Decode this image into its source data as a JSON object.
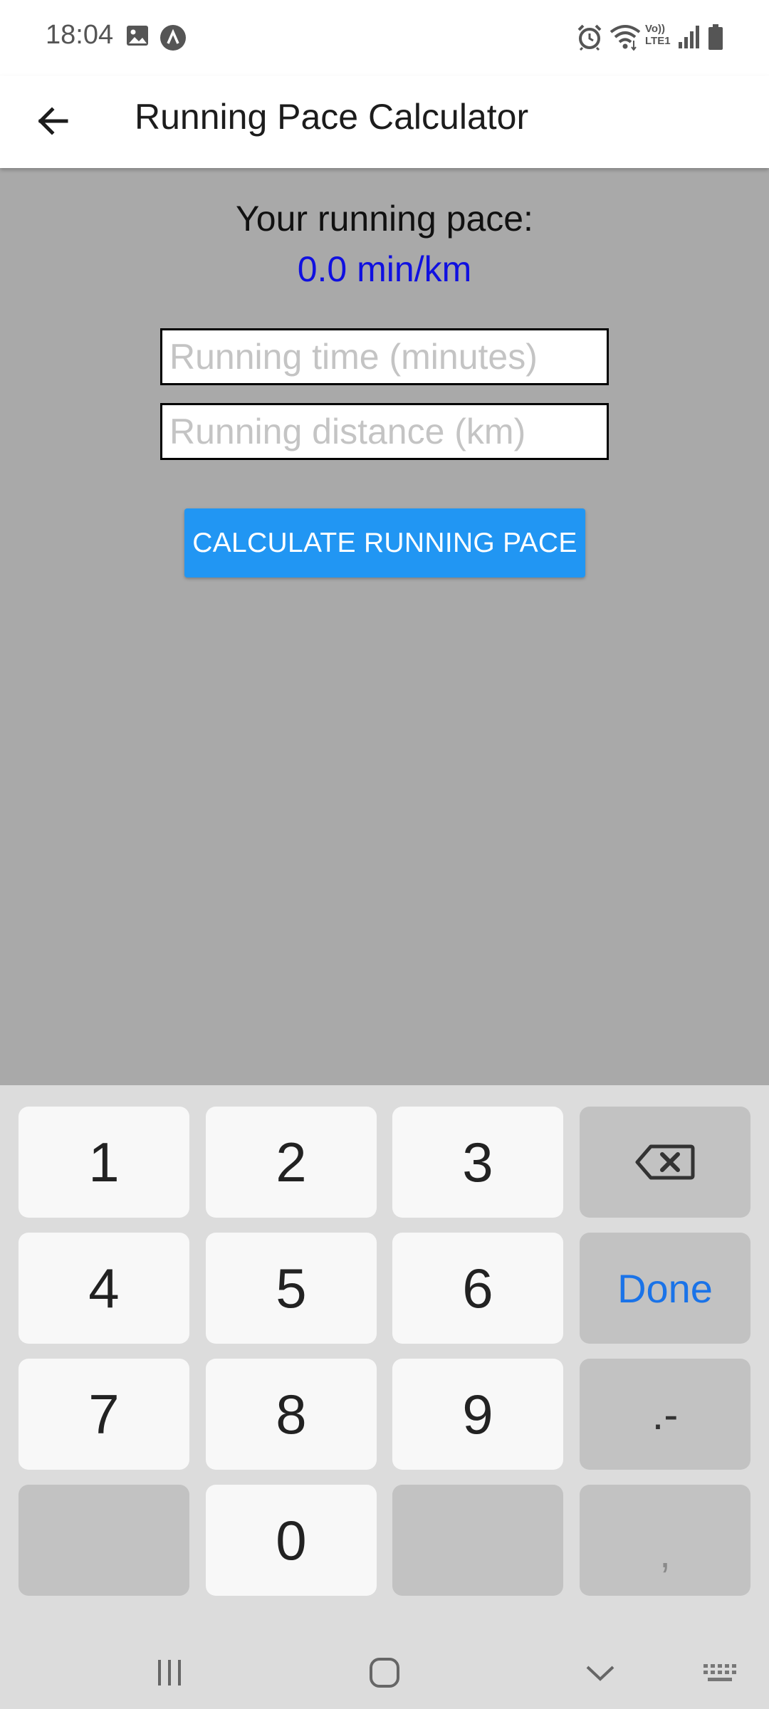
{
  "status_bar": {
    "time": "18:04",
    "left_icons": [
      "image-icon",
      "assistant-icon"
    ],
    "right_icons": [
      "alarm-icon",
      "wifi-icon",
      "volte-icon",
      "signal-icon",
      "battery-icon"
    ],
    "volte_label_top": "Vo))",
    "volte_label_bottom": "LTE1"
  },
  "app_bar": {
    "back_icon": "arrow-left-icon",
    "title": "Running Pace Calculator"
  },
  "main": {
    "pace_label": "Your running pace:",
    "pace_value": "0.0 min/km",
    "time_input": {
      "placeholder": "Running time (minutes)",
      "value": ""
    },
    "distance_input": {
      "placeholder": "Running distance (km)",
      "value": ""
    },
    "calculate_button": "CALCULATE RUNNING PACE"
  },
  "keyboard": {
    "keys": [
      "1",
      "2",
      "3",
      "4",
      "5",
      "6",
      "7",
      "8",
      "9",
      "0"
    ],
    "backspace_icon": "backspace-icon",
    "done_label": "Done",
    "dot_minus_label": ".-",
    "comma_label": ","
  },
  "nav_bar": {
    "icons": [
      "recent-apps-icon",
      "home-icon",
      "hide-keyboard-icon",
      "keyboard-icon"
    ]
  },
  "colors": {
    "background_content": "#a9a9a9",
    "pace_value": "#1010e0",
    "button": "#2196f3",
    "keyboard_bg": "#dcdcdc",
    "done_text": "#1a73e8"
  }
}
